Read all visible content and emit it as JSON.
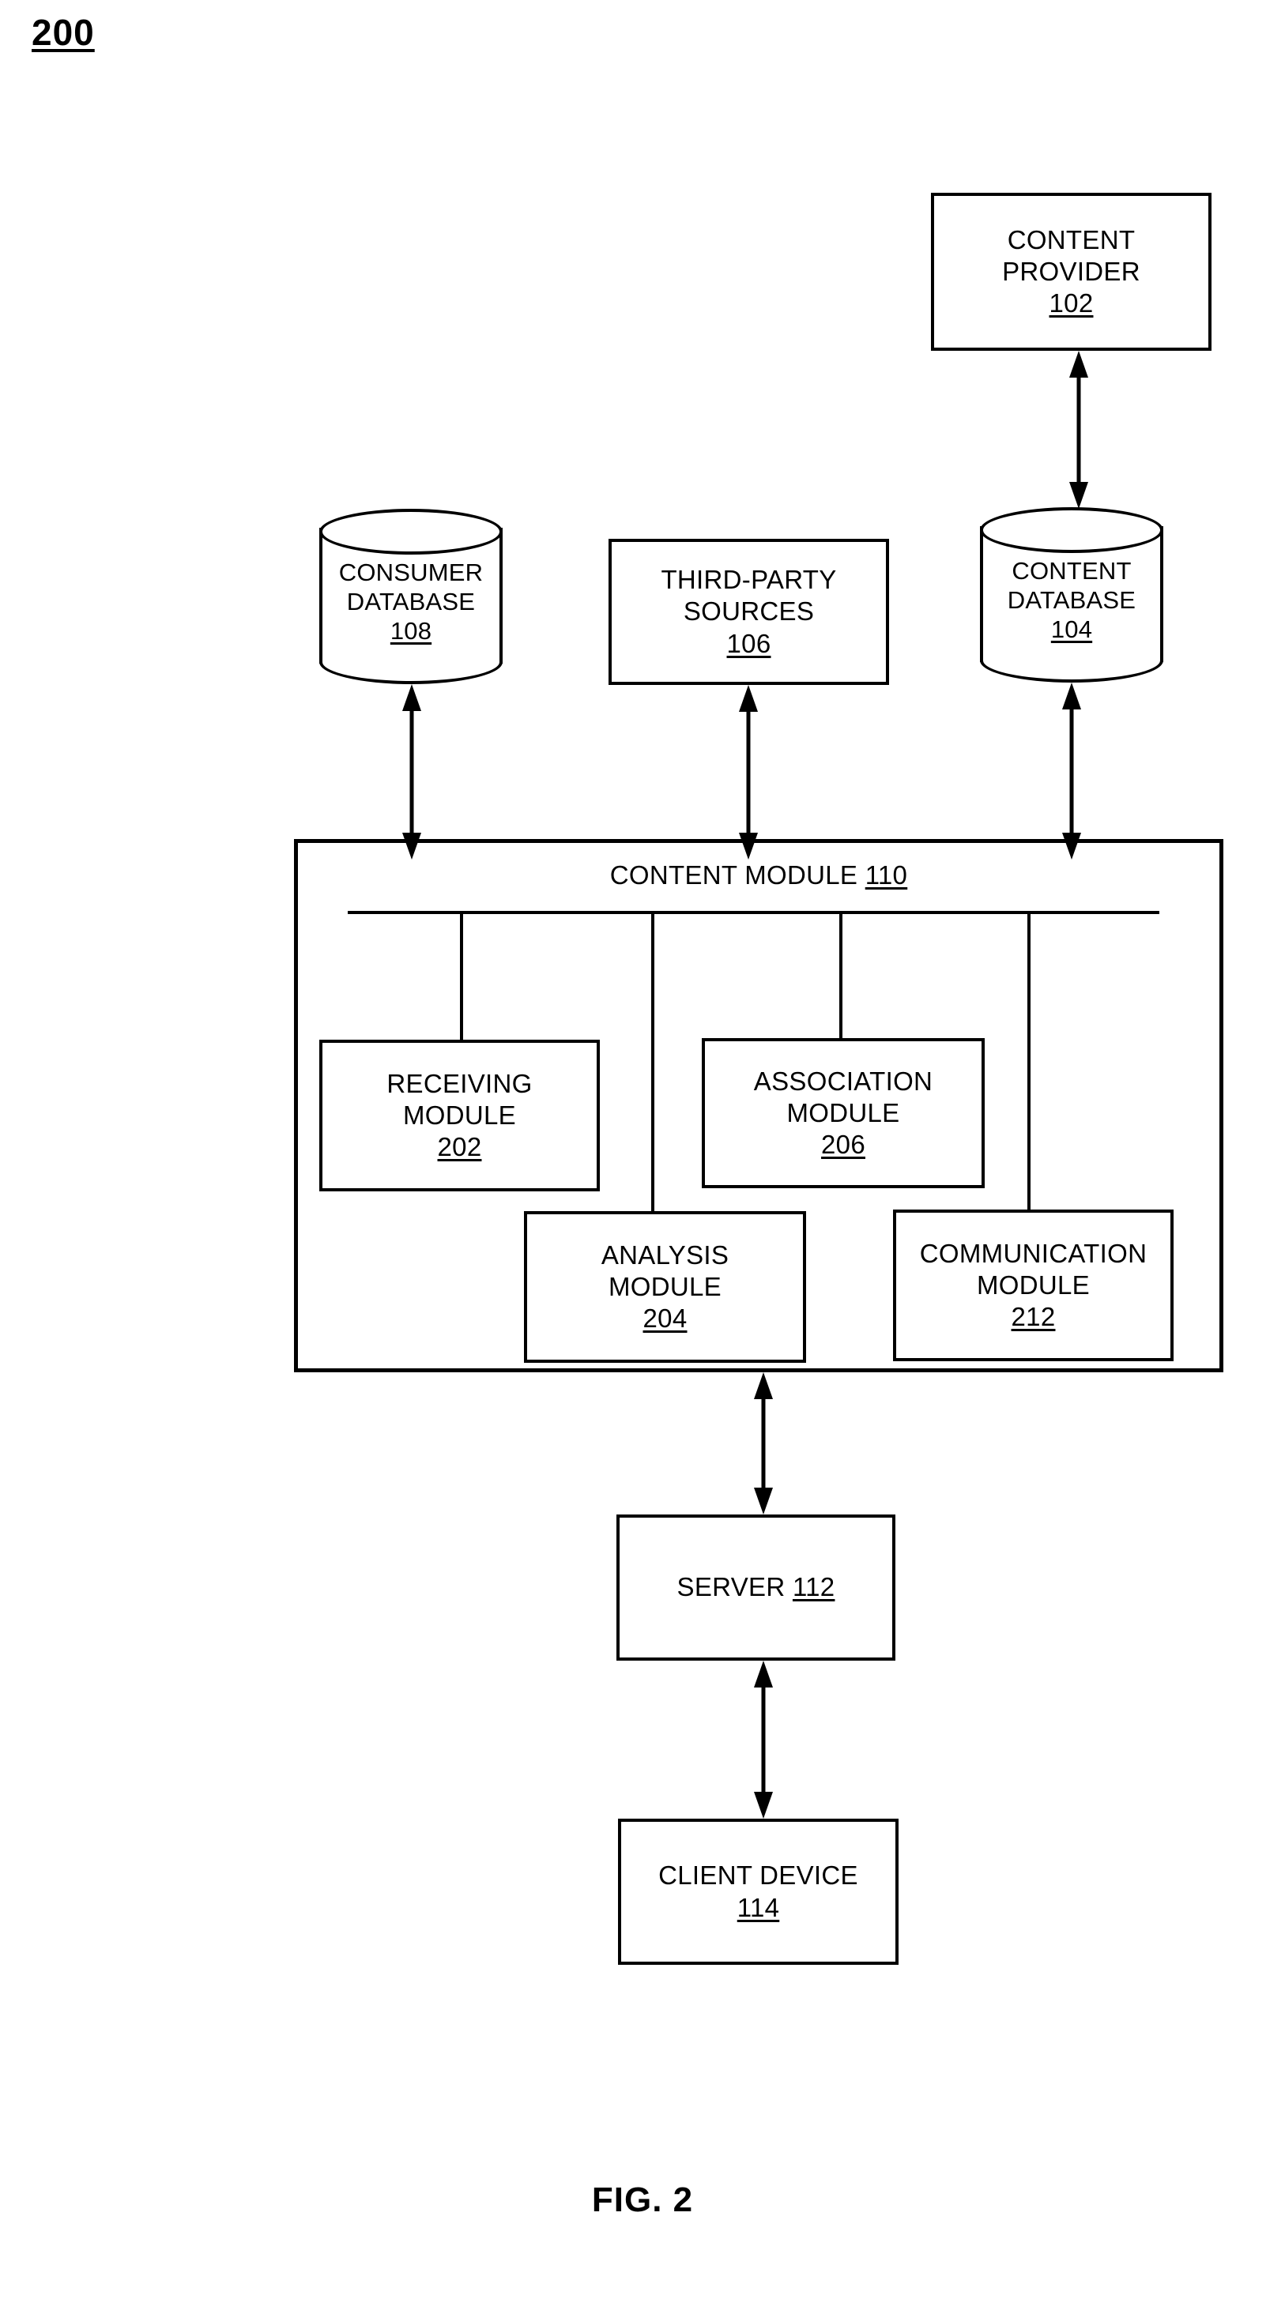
{
  "figure": {
    "number": "200",
    "caption": "FIG. 2"
  },
  "nodes": {
    "content_provider": {
      "lines": [
        "CONTENT",
        "PROVIDER"
      ],
      "ref": "102"
    },
    "consumer_database": {
      "lines": [
        "CONSUMER",
        "DATABASE"
      ],
      "ref": "108"
    },
    "third_party_sources": {
      "lines": [
        "THIRD-PARTY",
        "SOURCES"
      ],
      "ref": "106"
    },
    "content_database": {
      "lines": [
        "CONTENT",
        "DATABASE"
      ],
      "ref": "104"
    },
    "content_module": {
      "title": "CONTENT MODULE",
      "ref": "110"
    },
    "receiving_module": {
      "lines": [
        "RECEIVING",
        "MODULE"
      ],
      "ref": "202"
    },
    "association_module": {
      "lines": [
        "ASSOCIATION",
        "MODULE"
      ],
      "ref": "206"
    },
    "analysis_module": {
      "lines": [
        "ANALYSIS",
        "MODULE"
      ],
      "ref": "204"
    },
    "communication_module": {
      "lines": [
        "COMMUNICATION",
        "MODULE"
      ],
      "ref": "212"
    },
    "server": {
      "title": "SERVER",
      "ref": "112"
    },
    "client_device": {
      "lines": [
        "CLIENT DEVICE"
      ],
      "ref": "114"
    }
  },
  "colors": {
    "stroke": "#000000",
    "background": "#ffffff"
  }
}
